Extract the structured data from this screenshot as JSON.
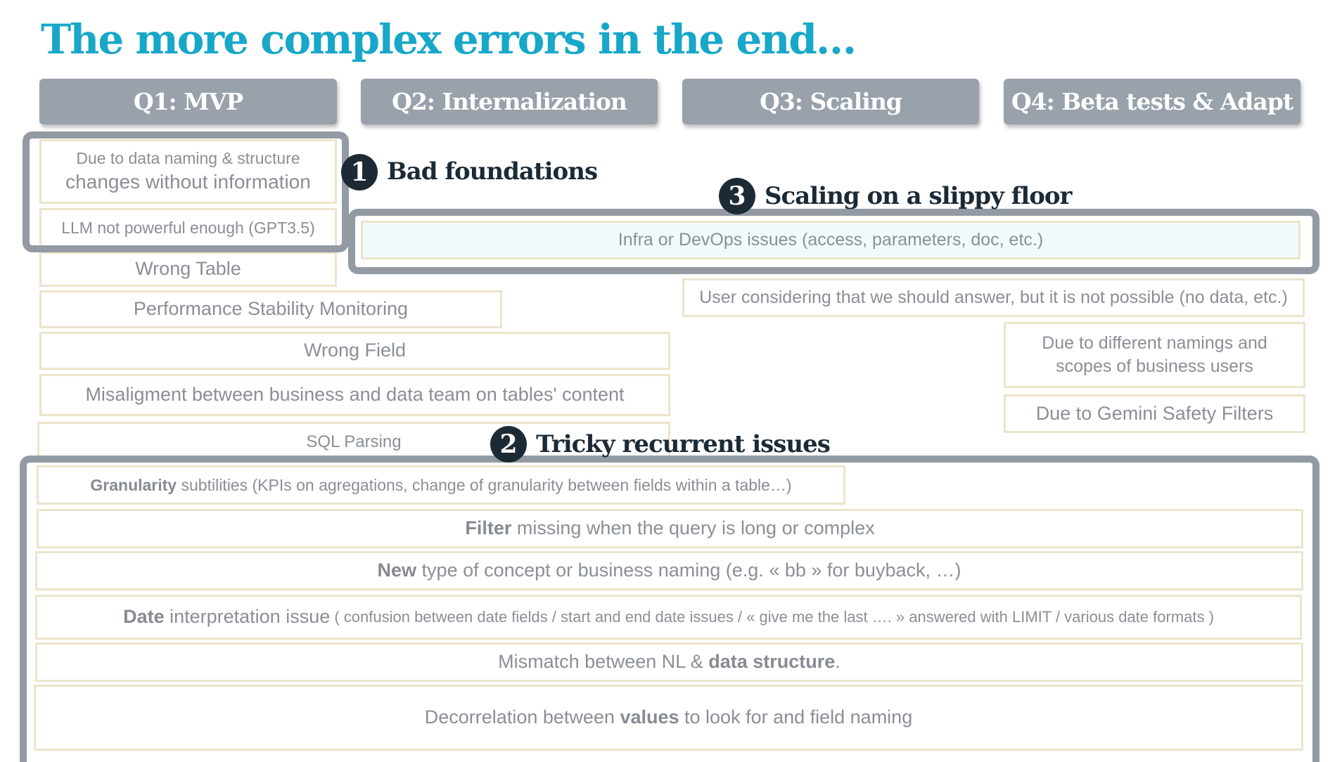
{
  "title": "The more complex errors in the end…",
  "quarters": [
    {
      "label": "Q1: MVP"
    },
    {
      "label": "Q2: Internalization"
    },
    {
      "label": "Q3: Scaling"
    },
    {
      "label": "Q4: Beta tests & Adapt"
    }
  ],
  "groups": {
    "bad_foundations": {
      "number": "1",
      "label": "Bad foundations"
    },
    "tricky_recurrent": {
      "number": "2",
      "label": "Tricky recurrent issues"
    },
    "scaling_slippy": {
      "number": "3",
      "label": "Scaling on a slippy floor"
    }
  },
  "q1_items": {
    "data_naming_line1": "Due to data naming & structure",
    "data_naming_line2": "changes without information",
    "llm_weak": "LLM not powerful enough (GPT3.5)",
    "wrong_table": "Wrong Table",
    "performance": "Performance Stability Monitoring",
    "wrong_field": "Wrong Field",
    "misalignment": "Misaligment between business and data team on tables' content",
    "sql_parsing": "SQL Parsing"
  },
  "scaling_items": {
    "infra": "Infra or DevOps issues (access, parameters, doc, etc.)",
    "user_expect": "User considering that we should answer, but it is not possible (no data, etc.)",
    "namings_line1": "Due to different namings and",
    "namings_line2": "scopes of business users",
    "gemini": "Due to Gemini Safety Filters"
  },
  "tricky_items": {
    "granularity": {
      "bold": "Granularity",
      "rest": " subtilities (KPIs on agregations, change of granularity between fields within a table…)"
    },
    "filter": {
      "bold": "Filter",
      "rest": " missing when the query is long or complex"
    },
    "new_concept": {
      "bold": "New",
      "rest": " type of concept or business naming (e.g. « bb » for buyback, …)"
    },
    "date": {
      "bold": "Date",
      "rest": " interpretation issue",
      "detail": " ( confusion between date fields / start and end date issues / « give me the last …. » answered with LIMIT / various date formats )"
    },
    "mismatch": {
      "pre": "Mismatch between NL & ",
      "bold": "data structure",
      "post": "."
    },
    "decorrelation": {
      "pre": "Decorrelation between ",
      "bold": "values",
      "post": " to look for and field naming"
    }
  },
  "colors": {
    "title": "#17a7c8",
    "quarter_header": "#99a1ab",
    "frame": "#939aa3",
    "box_border": "#ece4cc",
    "item_text": "#8a8f95",
    "label": "#1c2a36"
  }
}
